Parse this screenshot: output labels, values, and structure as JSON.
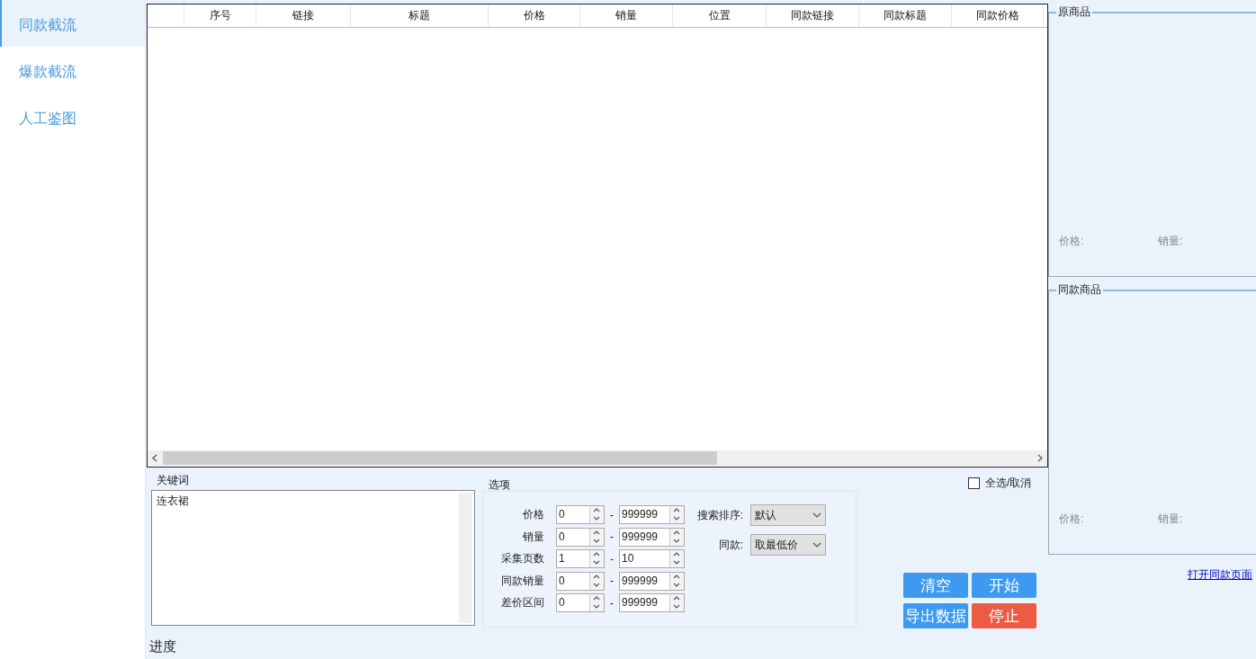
{
  "sidebar": {
    "items": [
      {
        "label": "同款截流",
        "selected": true
      },
      {
        "label": "爆款截流",
        "selected": false
      },
      {
        "label": "人工鉴图",
        "selected": false
      }
    ]
  },
  "table": {
    "columns": [
      "序号",
      "链接",
      "标题",
      "价格",
      "销量",
      "位置",
      "同款链接",
      "同款标题",
      "同款价格"
    ]
  },
  "keywords": {
    "label": "关键词",
    "value": "连衣裙"
  },
  "options": {
    "title": "选项",
    "ranges": [
      {
        "label": "价格",
        "min": "0",
        "separator": "-",
        "max": "999999"
      },
      {
        "label": "销量",
        "min": "0",
        "separator": "-",
        "max": "999999"
      },
      {
        "label": "采集页数",
        "min": "1",
        "separator": "-",
        "max": "10"
      },
      {
        "label": "同款销量",
        "min": "0",
        "separator": "-",
        "max": "999999"
      },
      {
        "label": "差价区间",
        "min": "0",
        "separator": "-",
        "max": "999999"
      }
    ],
    "selects": [
      {
        "label": "搜索排序:",
        "value": "默认"
      },
      {
        "label": "同款:",
        "value": "取最低价"
      }
    ]
  },
  "select_all": {
    "label": "全选/取消",
    "checked": false
  },
  "buttons": [
    {
      "label": "清空",
      "kind": "primary"
    },
    {
      "label": "开始",
      "kind": "primary"
    },
    {
      "label": "导出数据",
      "kind": "primary"
    },
    {
      "label": "停止",
      "kind": "danger"
    }
  ],
  "progress_label": "进度",
  "original_product": {
    "title": "原商品",
    "price_label": "价格:",
    "sales_label": "销量:"
  },
  "same_product": {
    "title": "同款商品",
    "price_label": "价格:",
    "sales_label": "销量:"
  },
  "open_link": "打开同款页面"
}
